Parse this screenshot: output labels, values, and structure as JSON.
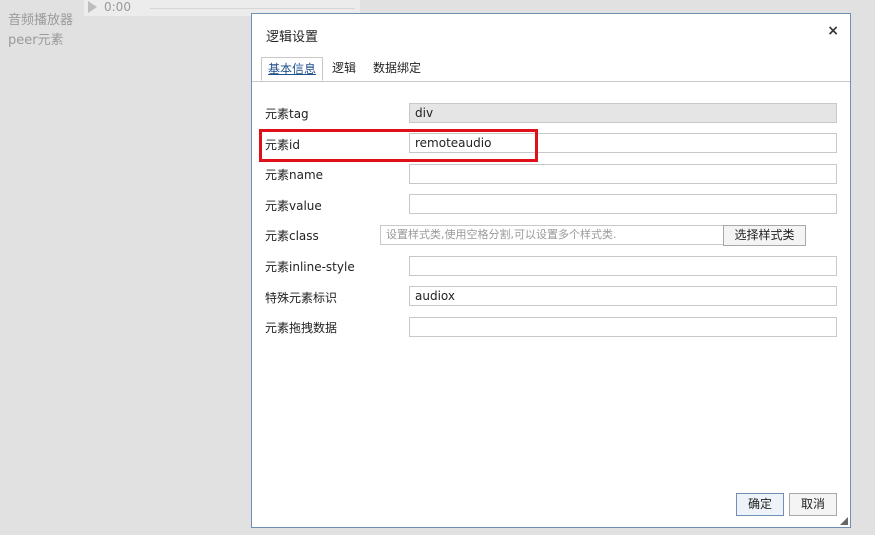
{
  "background": {
    "audio_player_label": "音频播放器",
    "peer_label": "peer元素",
    "player_time": "0:00"
  },
  "dialog": {
    "title": "逻辑设置",
    "close_glyph": "×",
    "tabs": [
      "基本信息",
      "逻辑",
      "数据绑定"
    ],
    "active_tab": "基本信息",
    "fields": {
      "tag": {
        "label": "元素tag",
        "value": "div"
      },
      "id": {
        "label": "元素id",
        "value": "remoteaudio"
      },
      "name": {
        "label": "元素name",
        "value": ""
      },
      "value": {
        "label": "元素value",
        "value": ""
      },
      "class": {
        "label": "元素class",
        "value": "",
        "placeholder": "设置样式类,使用空格分割,可以设置多个样式类.",
        "button": "选择样式类"
      },
      "inline_style": {
        "label": "元素inline-style",
        "value": ""
      },
      "special_id": {
        "label": "特殊元素标识",
        "value": "audiox"
      },
      "drag_data": {
        "label": "元素拖拽数据",
        "value": ""
      }
    },
    "buttons": {
      "ok": "确定",
      "cancel": "取消"
    },
    "colors": {
      "highlight": "#e0101a",
      "tab_active": "#1f4e8c",
      "border": "#6f8fb5"
    }
  }
}
